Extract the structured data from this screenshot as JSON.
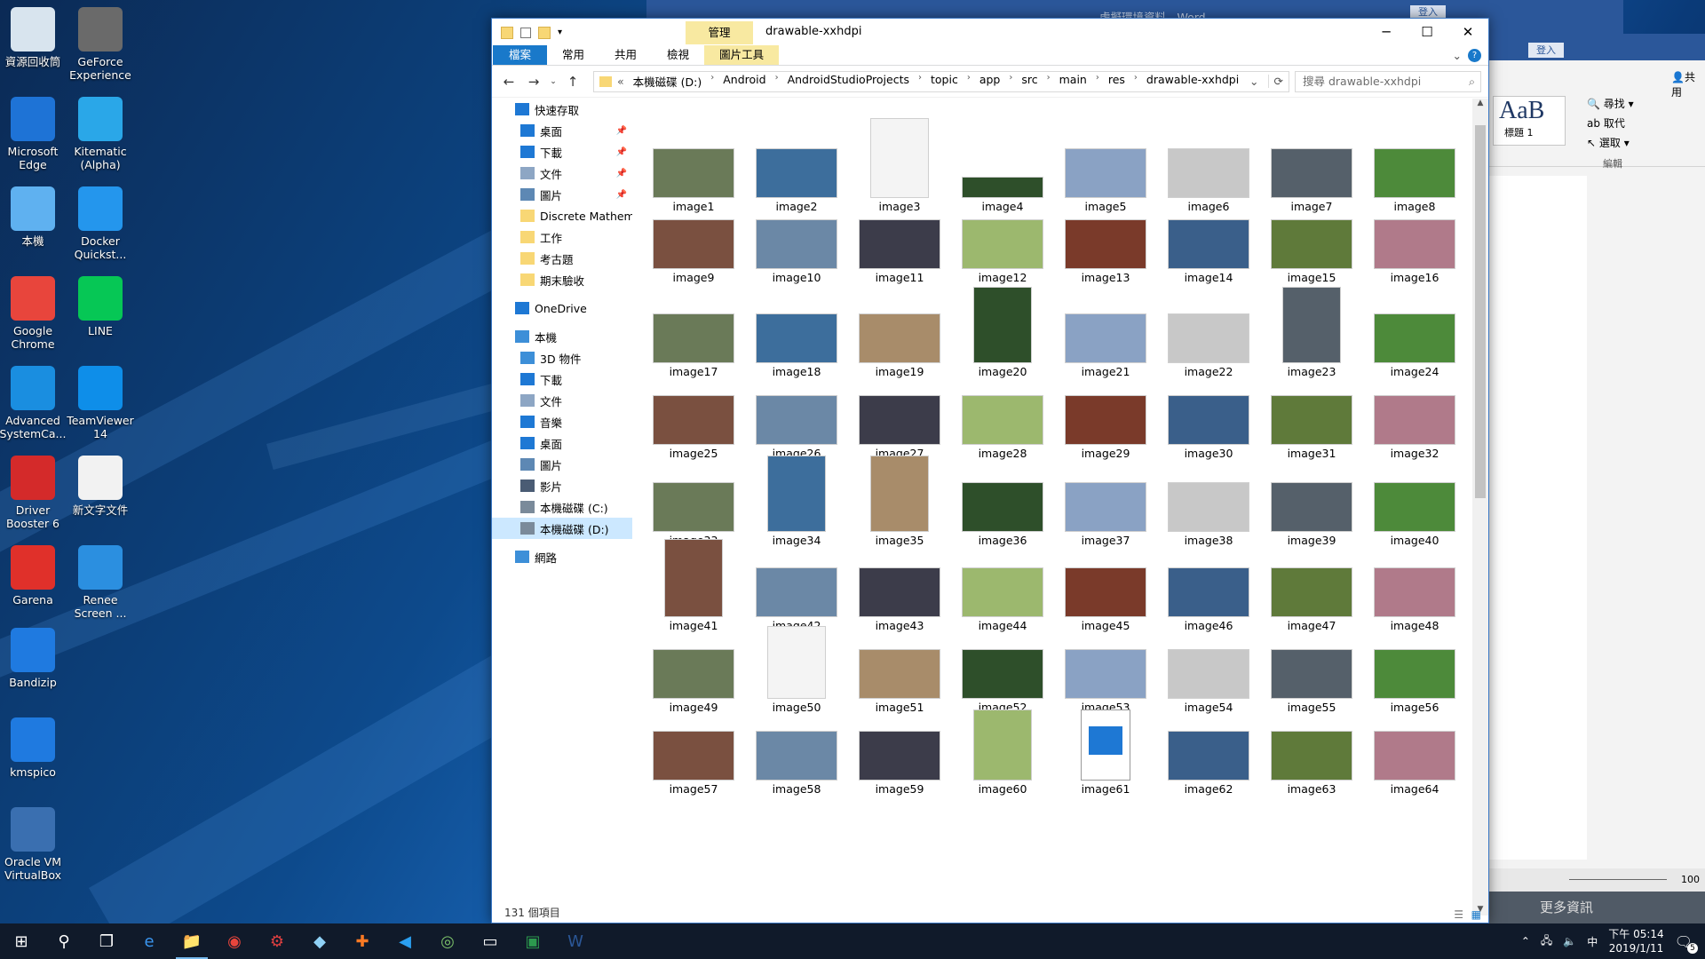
{
  "desktop": {
    "icons": [
      {
        "label": "資源回收筒",
        "icon": "recycle-bin-icon",
        "color": "#d8e4ee"
      },
      {
        "label": "GeForce Experience",
        "icon": "geforce-icon",
        "color": "#6a6a6a"
      },
      {
        "label": "Microsoft Edge",
        "icon": "edge-icon",
        "color": "#1e73d6"
      },
      {
        "label": "Kitematic (Alpha)",
        "icon": "kitematic-icon",
        "color": "#2aa7e8"
      },
      {
        "label": "本機",
        "icon": "this-pc-icon",
        "color": "#5fb1f0"
      },
      {
        "label": "Docker Quickst...",
        "icon": "docker-icon",
        "color": "#2496ed"
      },
      {
        "label": "Google Chrome",
        "icon": "chrome-icon",
        "color": "#e8453c"
      },
      {
        "label": "LINE",
        "icon": "line-icon",
        "color": "#06c755"
      },
      {
        "label": "Advanced SystemCa...",
        "icon": "advanced-systemcare-icon",
        "color": "#1a8ee0"
      },
      {
        "label": "TeamViewer 14",
        "icon": "teamviewer-icon",
        "color": "#0e8ee9"
      },
      {
        "label": "Driver Booster 6",
        "icon": "driver-booster-icon",
        "color": "#d42a2a"
      },
      {
        "label": "新文字文件",
        "icon": "text-file-icon",
        "color": "#f2f2f2"
      },
      {
        "label": "Garena",
        "icon": "garena-icon",
        "color": "#e0302a"
      },
      {
        "label": "Renee Screen ...",
        "icon": "renee-icon",
        "color": "#2b8fe0"
      },
      {
        "label": "Bandizip",
        "icon": "bandizip-icon",
        "color": "#1f7ae0"
      },
      {
        "label": "kmspico",
        "icon": "kmspico-icon",
        "color": "#1f7ae0"
      },
      {
        "label": "Oracle VM VirtualBox",
        "icon": "virtualbox-icon",
        "color": "#3a6fb0"
      }
    ]
  },
  "explorer": {
    "title": "drawable-xxhdpi",
    "context_tab": "管理",
    "ribbon_tabs": [
      "檔案",
      "常用",
      "共用",
      "檢視",
      "圖片工具"
    ],
    "path_prefix": "«",
    "breadcrumb": [
      "本機磁碟 (D:)",
      "Android",
      "AndroidStudioProjects",
      "topic",
      "app",
      "src",
      "main",
      "res",
      "drawable-xxhdpi"
    ],
    "search_placeholder": "搜尋 drawable-xxhdpi",
    "nav": [
      {
        "label": "快速存取",
        "icon": "star-icon",
        "level": 1,
        "pinned": false,
        "color": "#1e78d4"
      },
      {
        "label": "桌面",
        "icon": "desktop-folder-icon",
        "level": 2,
        "pinned": true,
        "color": "#1e78d4"
      },
      {
        "label": "下載",
        "icon": "download-icon",
        "level": 2,
        "pinned": true,
        "color": "#1e78d4"
      },
      {
        "label": "文件",
        "icon": "documents-icon",
        "level": 2,
        "pinned": true,
        "color": "#8da6c4"
      },
      {
        "label": "圖片",
        "icon": "pictures-icon",
        "level": 2,
        "pinned": true,
        "color": "#5d88b4"
      },
      {
        "label": "Discrete Mathema",
        "icon": "folder-icon",
        "level": 2,
        "pinned": false,
        "color": "#f8d775"
      },
      {
        "label": "工作",
        "icon": "folder-icon",
        "level": 2,
        "pinned": false,
        "color": "#f8d775"
      },
      {
        "label": "考古題",
        "icon": "folder-icon",
        "level": 2,
        "pinned": false,
        "color": "#f8d775"
      },
      {
        "label": "期末驗收",
        "icon": "folder-icon",
        "level": 2,
        "pinned": false,
        "color": "#f8d775"
      },
      {
        "label": "",
        "icon": "",
        "level": 0,
        "pinned": false,
        "color": ""
      },
      {
        "label": "OneDrive",
        "icon": "onedrive-icon",
        "level": 1,
        "pinned": false,
        "color": "#1e78d4"
      },
      {
        "label": "",
        "icon": "",
        "level": 0,
        "pinned": false,
        "color": ""
      },
      {
        "label": "本機",
        "icon": "this-pc-icon",
        "level": 1,
        "pinned": false,
        "color": "#3d8fd8"
      },
      {
        "label": "3D 物件",
        "icon": "3d-objects-icon",
        "level": 2,
        "pinned": false,
        "color": "#3d8fd8"
      },
      {
        "label": "下載",
        "icon": "download-icon",
        "level": 2,
        "pinned": false,
        "color": "#1e78d4"
      },
      {
        "label": "文件",
        "icon": "documents-icon",
        "level": 2,
        "pinned": false,
        "color": "#8da6c4"
      },
      {
        "label": "音樂",
        "icon": "music-icon",
        "level": 2,
        "pinned": false,
        "color": "#1e78d4"
      },
      {
        "label": "桌面",
        "icon": "desktop-folder-icon",
        "level": 2,
        "pinned": false,
        "color": "#1e78d4"
      },
      {
        "label": "圖片",
        "icon": "pictures-icon",
        "level": 2,
        "pinned": false,
        "color": "#5d88b4"
      },
      {
        "label": "影片",
        "icon": "videos-icon",
        "level": 2,
        "pinned": false,
        "color": "#4a5c74"
      },
      {
        "label": "本機磁碟 (C:)",
        "icon": "drive-c-icon",
        "level": 2,
        "pinned": false,
        "color": "#7a8a9a"
      },
      {
        "label": "本機磁碟 (D:)",
        "icon": "drive-d-icon",
        "level": 2,
        "pinned": false,
        "color": "#7a8a9a",
        "selected": true
      },
      {
        "label": "",
        "icon": "",
        "level": 0,
        "pinned": false,
        "color": ""
      },
      {
        "label": "網路",
        "icon": "network-icon",
        "level": 1,
        "pinned": false,
        "color": "#3d8fd8"
      }
    ],
    "files": [
      "image1",
      "image2",
      "image3",
      "image4",
      "image5",
      "image6",
      "image7",
      "image8",
      "image9",
      "image10",
      "image11",
      "image12",
      "image13",
      "image14",
      "image15",
      "image16",
      "image17",
      "image18",
      "image19",
      "image20",
      "image21",
      "image22",
      "image23",
      "image24",
      "image25",
      "image26",
      "image27",
      "image28",
      "image29",
      "image30",
      "image31",
      "image32",
      "image33",
      "image34",
      "image35",
      "image36",
      "image37",
      "image38",
      "image39",
      "image40",
      "image41",
      "image42",
      "image43",
      "image44",
      "image45",
      "image46",
      "image47",
      "image48",
      "image49",
      "image50",
      "image51",
      "image52",
      "image53",
      "image54",
      "image55",
      "image56",
      "image57",
      "image58",
      "image59",
      "image60",
      "image61",
      "image62",
      "image63",
      "image64"
    ],
    "status": "131 個項目"
  },
  "word": {
    "title_fragment": "Word",
    "login": "登入",
    "share": "共用",
    "style_sample": "AaB",
    "style_name": "標題 1",
    "find": "尋找",
    "replace": "取代",
    "select": "選取",
    "group_label": "編輯",
    "more_info": "更多資訊",
    "zoom": "100"
  },
  "taskbar": {
    "apps": [
      "start-icon",
      "search-icon",
      "task-view-icon",
      "edge-icon",
      "file-explorer-icon",
      "chrome-icon",
      "driver-booster-icon",
      "notes-icon",
      "xampp-icon",
      "vscode-icon",
      "android-studio-icon",
      "app-window-icon",
      "excel-icon",
      "word-icon"
    ],
    "active_app": "file-explorer-icon",
    "time": "下午 05:14",
    "date": "2019/1/11",
    "ime": "中",
    "notifications": "5"
  }
}
